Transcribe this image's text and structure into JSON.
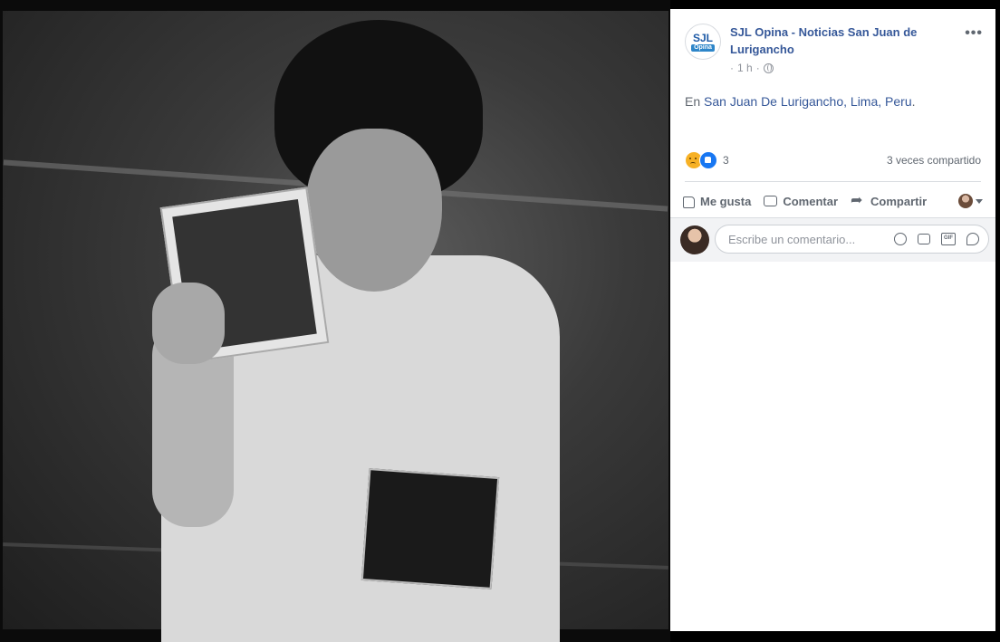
{
  "photo": {
    "alt_icon": "photo-image"
  },
  "post": {
    "page_name": "SJL Opina - Noticias San Juan de Lurigancho",
    "avatar_text_top": "SJL",
    "avatar_text_bottom": "Opina",
    "timestamp": "1 h",
    "meta_separator": "·",
    "location_prefix": "En",
    "location_link": "San Juan De Lurigancho, Lima, Peru",
    "location_suffix": "."
  },
  "reactions": {
    "count": "3",
    "shares": "3 veces compartido"
  },
  "actions": {
    "like": "Me gusta",
    "comment": "Comentar",
    "share": "Compartir"
  },
  "comment": {
    "placeholder": "Escribe un comentario..."
  },
  "icons": {
    "privacy": "globe-icon",
    "more": "more-icon",
    "reaction1": "sad-icon",
    "reaction2": "like-icon"
  }
}
